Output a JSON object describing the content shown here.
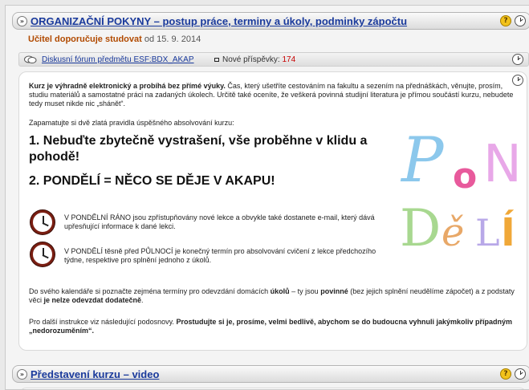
{
  "section1": {
    "title": "ORGANIZAČNÍ POKYNY – postup práce, terminy a úkoly, podminky zápočtu",
    "recommend_label": "Učitel doporučuje studovat",
    "recommend_date": "od 15. 9. 2014"
  },
  "forum": {
    "link": "Diskusní fórum předmětu ESF:BDX_AKAP",
    "count_label": "Nové příspěvky:",
    "count": "174"
  },
  "content": {
    "intro_bold": "Kurz je výhradně elektronický a probíhá bez přímé výuky.",
    "intro_rest": " Čas, který ušetříte cestováním na fakultu a sezením na přednáškách, věnujte, prosím, studiu materiálů a samostatné práci na zadaných úkolech. Určitě také oceníte, že veškerá povinná studijní literatura je přímou součástí kurzu, nebudete tedy muset nikde nic „shánět“.",
    "rules_intro": "Zapamatujte si dvě zlatá pravidla úspěšného absolvování kurzu:",
    "rule1": "1. Nebuďte zbytečně vystrašení, vše proběhne v klidu a pohodě!",
    "rule2": "2. PONDĚLÍ = NĚCO SE DĚJE V AKAPU!",
    "clock1_text": "V PONDĚLNÍ RÁNO jsou zpřístupňovány nové lekce a obvykle také dostanete e-mail, který dává upřesňující informace k dané lekci.",
    "clock2_text": "V PONDĚLÍ těsně před PŮLNOCÍ je konečný termín pro absolvování cvičení z lekce předchozího týdne, respektive pro splnění jednoho z úkolů.",
    "calendar_a": "Do svého kalendáře si poznačte zejména termíny pro odevzdání domácích ",
    "calendar_b": "úkolů",
    "calendar_c": " – ty jsou ",
    "calendar_d": "povinné",
    "calendar_e": " (bez jejich splnění neudělíme zápočet) a z podstaty věci ",
    "calendar_f": "je nelze odevzdat dodatečně",
    "calendar_g": ".",
    "further_a": "Pro další instrukce viz následující podosnovy. ",
    "further_b": "Prostudujte si je, prosíme, velmi bedlivě, abychom se do budoucna vyhnuli jakýmkoliv případným „nedorozuměním“."
  },
  "pondeli_art": {
    "letters": [
      "P",
      "o",
      "N",
      "D",
      "ě",
      "L",
      "Í"
    ],
    "colors": [
      "#8cc8ec",
      "#e85a9c",
      "#e8a8e8",
      "#a8d890",
      "#e8a868",
      "#b8a8e8",
      "#f0a838"
    ]
  },
  "section2": {
    "title": "Představení kurzu – video"
  },
  "icons": {
    "expand": "chevron-right-icon",
    "help": "info-icon",
    "history": "clock-icon"
  }
}
